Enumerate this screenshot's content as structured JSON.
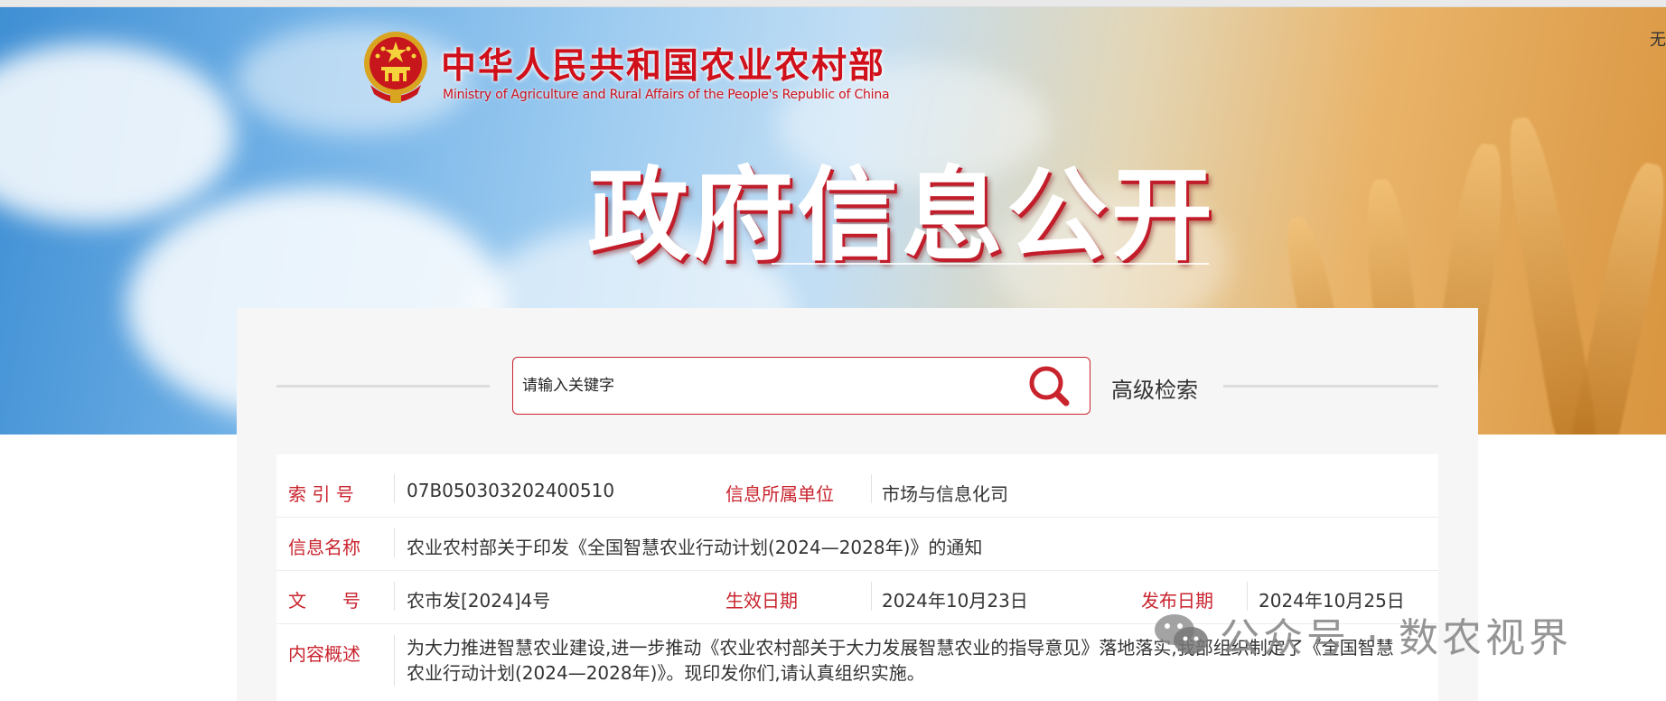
{
  "header": {
    "ministry_name_cn": "中华人民共和国农业农村部",
    "ministry_name_en": "Ministry of Agriculture and Rural Affairs of the People's Republic of China",
    "corner_text": "无",
    "section_title": "政府信息公开"
  },
  "search": {
    "placeholder": "请输入关键字",
    "value": "",
    "advanced_label": "高级检索"
  },
  "info": {
    "index_no_label": "索 引 号",
    "index_no": "07B050303202400510",
    "unit_label": "信息所属单位",
    "unit": "市场与信息化司",
    "name_label": "信息名称",
    "name": "农业农村部关于印发《全国智慧农业行动计划(2024—2028年)》的通知",
    "doc_no_label": "文　　号",
    "doc_no": "农市发[2024]4号",
    "effective_label": "生效日期",
    "effective_date": "2024年10月23日",
    "publish_label": "发布日期",
    "publish_date": "2024年10月25日",
    "summary_label": "内容概述",
    "summary": "为大力推进智慧农业建设,进一步推动《农业农村部关于大力发展智慧农业的指导意见》落地落实,我部组织制定了《全国智慧农业行动计划(2024—2028年)》。现印发你们,请认真组织实施。"
  },
  "watermark": {
    "text": "公众号 · 数农视界",
    "icon": "wechat-icon"
  },
  "colors": {
    "accent_red": "#c9242e",
    "banner_sky": "#6fb0e6",
    "banner_wheat": "#d9953f"
  }
}
